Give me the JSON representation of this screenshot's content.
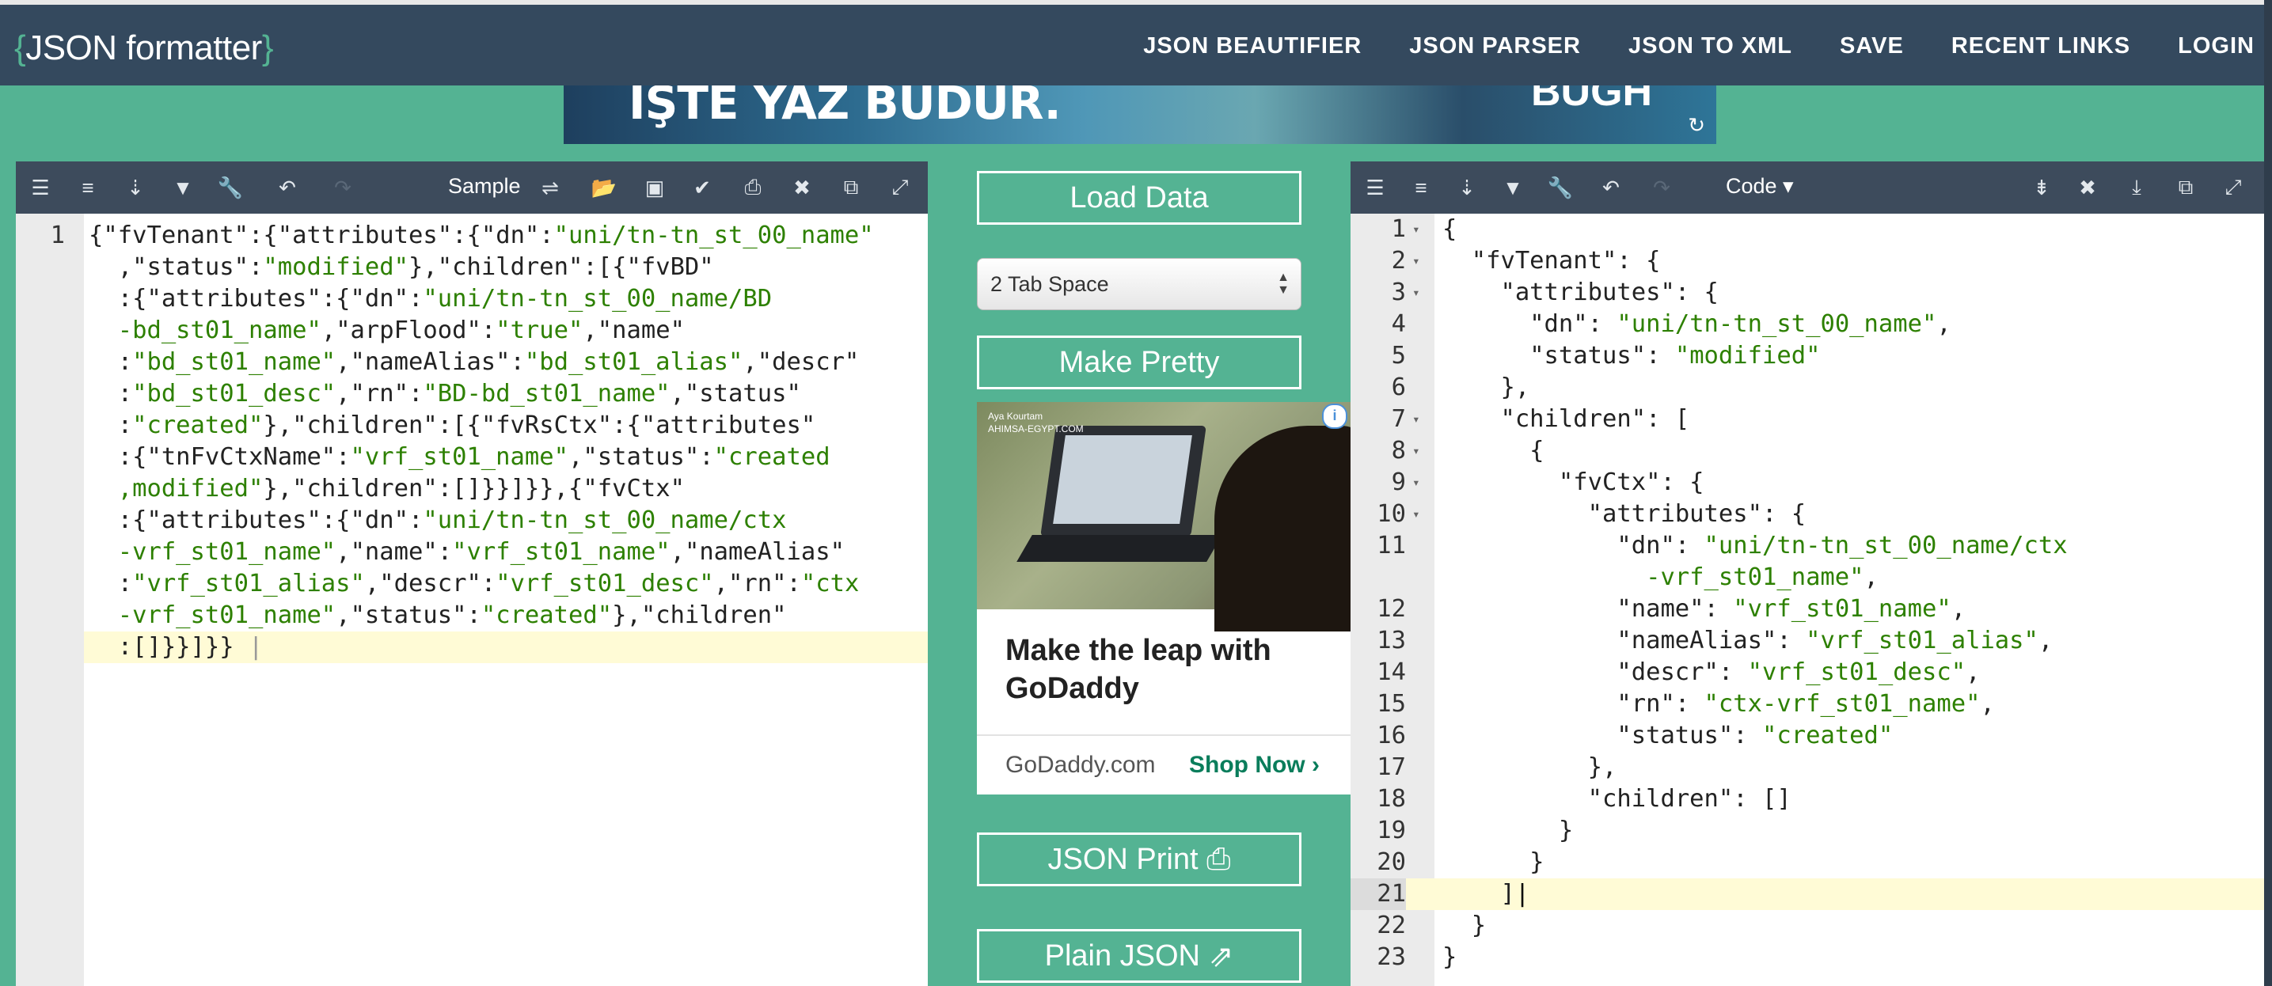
{
  "nav": {
    "logo_open": "{",
    "logo_text": "JSON formatter",
    "logo_close": "}",
    "links": [
      "JSON BEAUTIFIER",
      "JSON PARSER",
      "JSON TO XML",
      "SAVE",
      "RECENT LINKS",
      "LOGIN"
    ]
  },
  "banner": {
    "text": "IŞTE YAZ BUDUR.",
    "text2": "BUGH"
  },
  "left_editor": {
    "sample_label": "Sample",
    "lines": [
      "1"
    ]
  },
  "right_editor": {
    "mode_label": "Code ▾"
  },
  "middle": {
    "load_data": "Load Data",
    "tab_select": "2 Tab Space",
    "make_pretty": "Make Pretty",
    "json_print": "JSON Print",
    "plain_json": "Plain JSON"
  },
  "ad": {
    "brand_line1": "Aya Kourtam",
    "brand_line2": "AHIMSA-EGYPT.COM",
    "headline": "Make the leap with GoDaddy",
    "domain": "GoDaddy.com",
    "cta": "Shop Now"
  }
}
